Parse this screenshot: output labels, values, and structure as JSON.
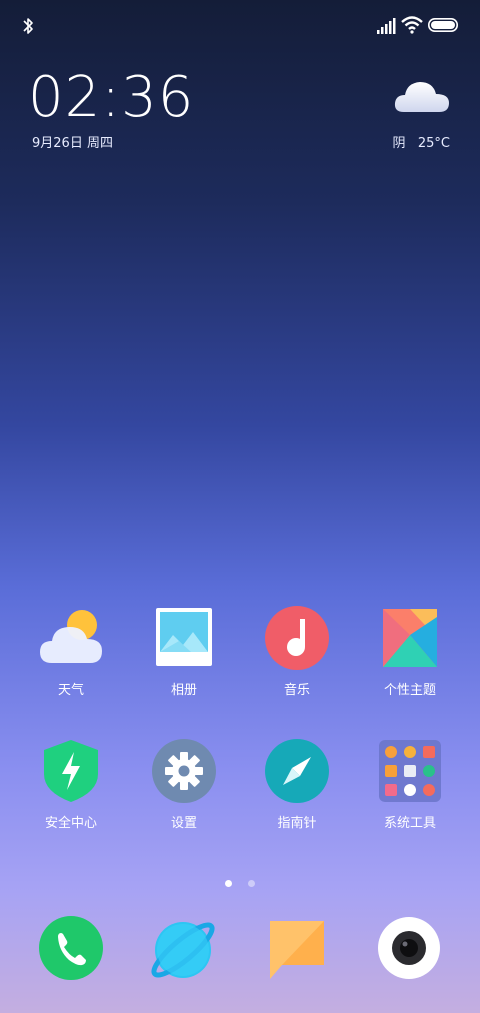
{
  "status_bar": {
    "bluetooth_icon": "bluetooth-icon",
    "signal_icon": "signal-icon",
    "wifi_icon": "wifi-icon",
    "battery_icon": "battery-icon"
  },
  "clock": {
    "time": "02:36",
    "date": "9月26日 周四"
  },
  "weather": {
    "icon": "cloud-icon",
    "condition": "阴",
    "temperature": "25°C"
  },
  "apps_row1": [
    {
      "label": "天气",
      "icon": "weather-app-icon"
    },
    {
      "label": "相册",
      "icon": "gallery-icon"
    },
    {
      "label": "音乐",
      "icon": "music-icon"
    },
    {
      "label": "个性主题",
      "icon": "themes-icon"
    }
  ],
  "apps_row2": [
    {
      "label": "安全中心",
      "icon": "security-icon"
    },
    {
      "label": "设置",
      "icon": "settings-icon"
    },
    {
      "label": "指南针",
      "icon": "compass-icon"
    },
    {
      "label": "系统工具",
      "icon": "folder-icon"
    }
  ],
  "page_indicator": {
    "pages": 2,
    "current": 1
  },
  "dock": [
    {
      "icon": "phone-icon"
    },
    {
      "icon": "browser-icon"
    },
    {
      "icon": "messages-icon"
    },
    {
      "icon": "camera-icon"
    }
  ],
  "colors": {
    "music": "#f05d68",
    "security": "#1fd07f",
    "settings": "#6f8ab0",
    "compass": "#16a9b8",
    "phone": "#1fc86a",
    "browser": "#2cc6f3",
    "messages": "#ffc26a"
  }
}
